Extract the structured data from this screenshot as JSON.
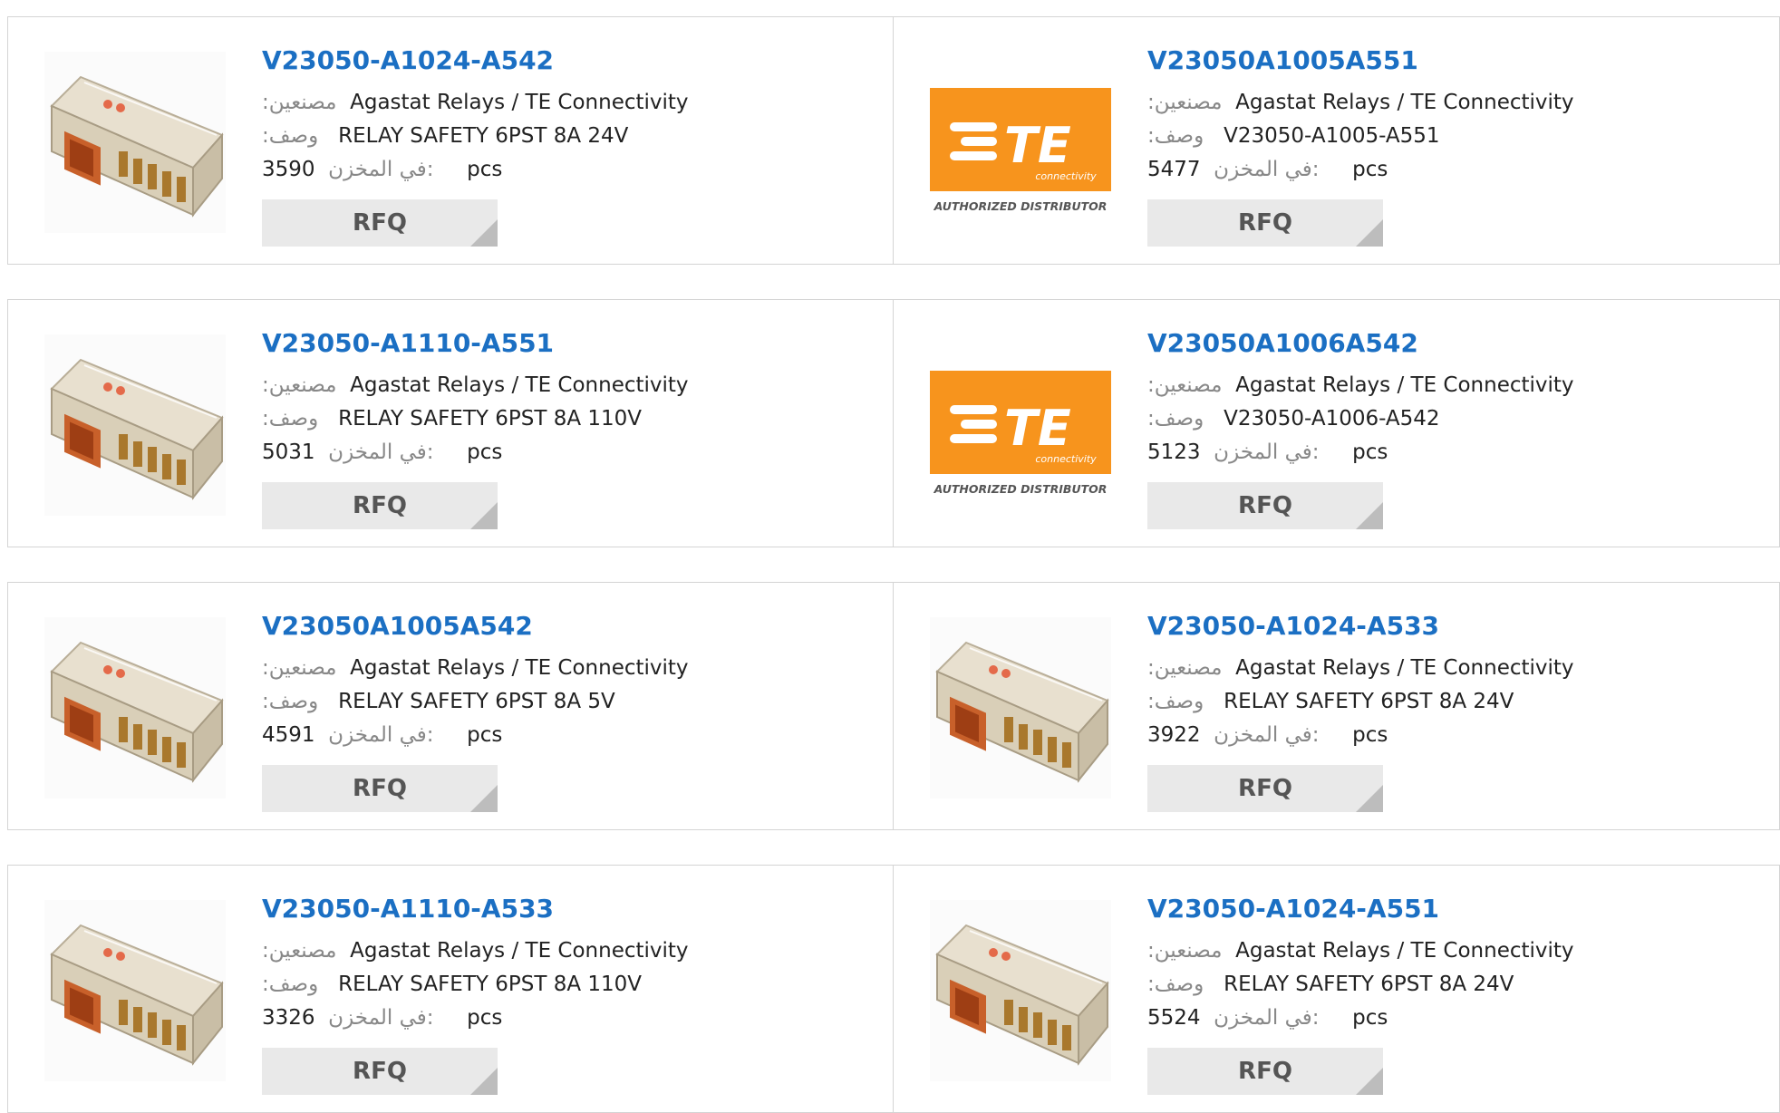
{
  "labels": {
    "manufacturer": ":مصنعين",
    "description": ":وصف",
    "stock": "في المخزن:",
    "pcs": "pcs",
    "rfq": "RFQ"
  },
  "brand": {
    "logo_text": "TE",
    "logo_sub": "connectivity",
    "logo_caption": "AUTHORIZED DISTRIBUTOR",
    "logo_color": "#f7941d"
  },
  "accent_color": "#1b6fc3",
  "products": [
    {
      "part": "V23050-A1024-A542",
      "manufacturer": "Agastat Relays / TE Connectivity",
      "description": "RELAY SAFETY 6PST 8A 24V",
      "stock": "3590",
      "image": "relay-photo"
    },
    {
      "part": "V23050A1005A551",
      "manufacturer": "Agastat Relays / TE Connectivity",
      "description": "V23050-A1005-A551",
      "stock": "5477",
      "image": "te-logo"
    },
    {
      "part": "V23050-A1110-A551",
      "manufacturer": "Agastat Relays / TE Connectivity",
      "description": "RELAY SAFETY 6PST 8A 110V",
      "stock": "5031",
      "image": "relay-photo"
    },
    {
      "part": "V23050A1006A542",
      "manufacturer": "Agastat Relays / TE Connectivity",
      "description": "V23050-A1006-A542",
      "stock": "5123",
      "image": "te-logo"
    },
    {
      "part": "V23050A1005A542",
      "manufacturer": "Agastat Relays / TE Connectivity",
      "description": "RELAY SAFETY 6PST 8A 5V",
      "stock": "4591",
      "image": "relay-photo"
    },
    {
      "part": "V23050-A1024-A533",
      "manufacturer": "Agastat Relays / TE Connectivity",
      "description": "RELAY SAFETY 6PST 8A 24V",
      "stock": "3922",
      "image": "relay-photo"
    },
    {
      "part": "V23050-A1110-A533",
      "manufacturer": "Agastat Relays / TE Connectivity",
      "description": "RELAY SAFETY 6PST 8A 110V",
      "stock": "3326",
      "image": "relay-photo"
    },
    {
      "part": "V23050-A1024-A551",
      "manufacturer": "Agastat Relays / TE Connectivity",
      "description": "RELAY SAFETY 6PST 8A 24V",
      "stock": "5524",
      "image": "relay-photo"
    }
  ]
}
